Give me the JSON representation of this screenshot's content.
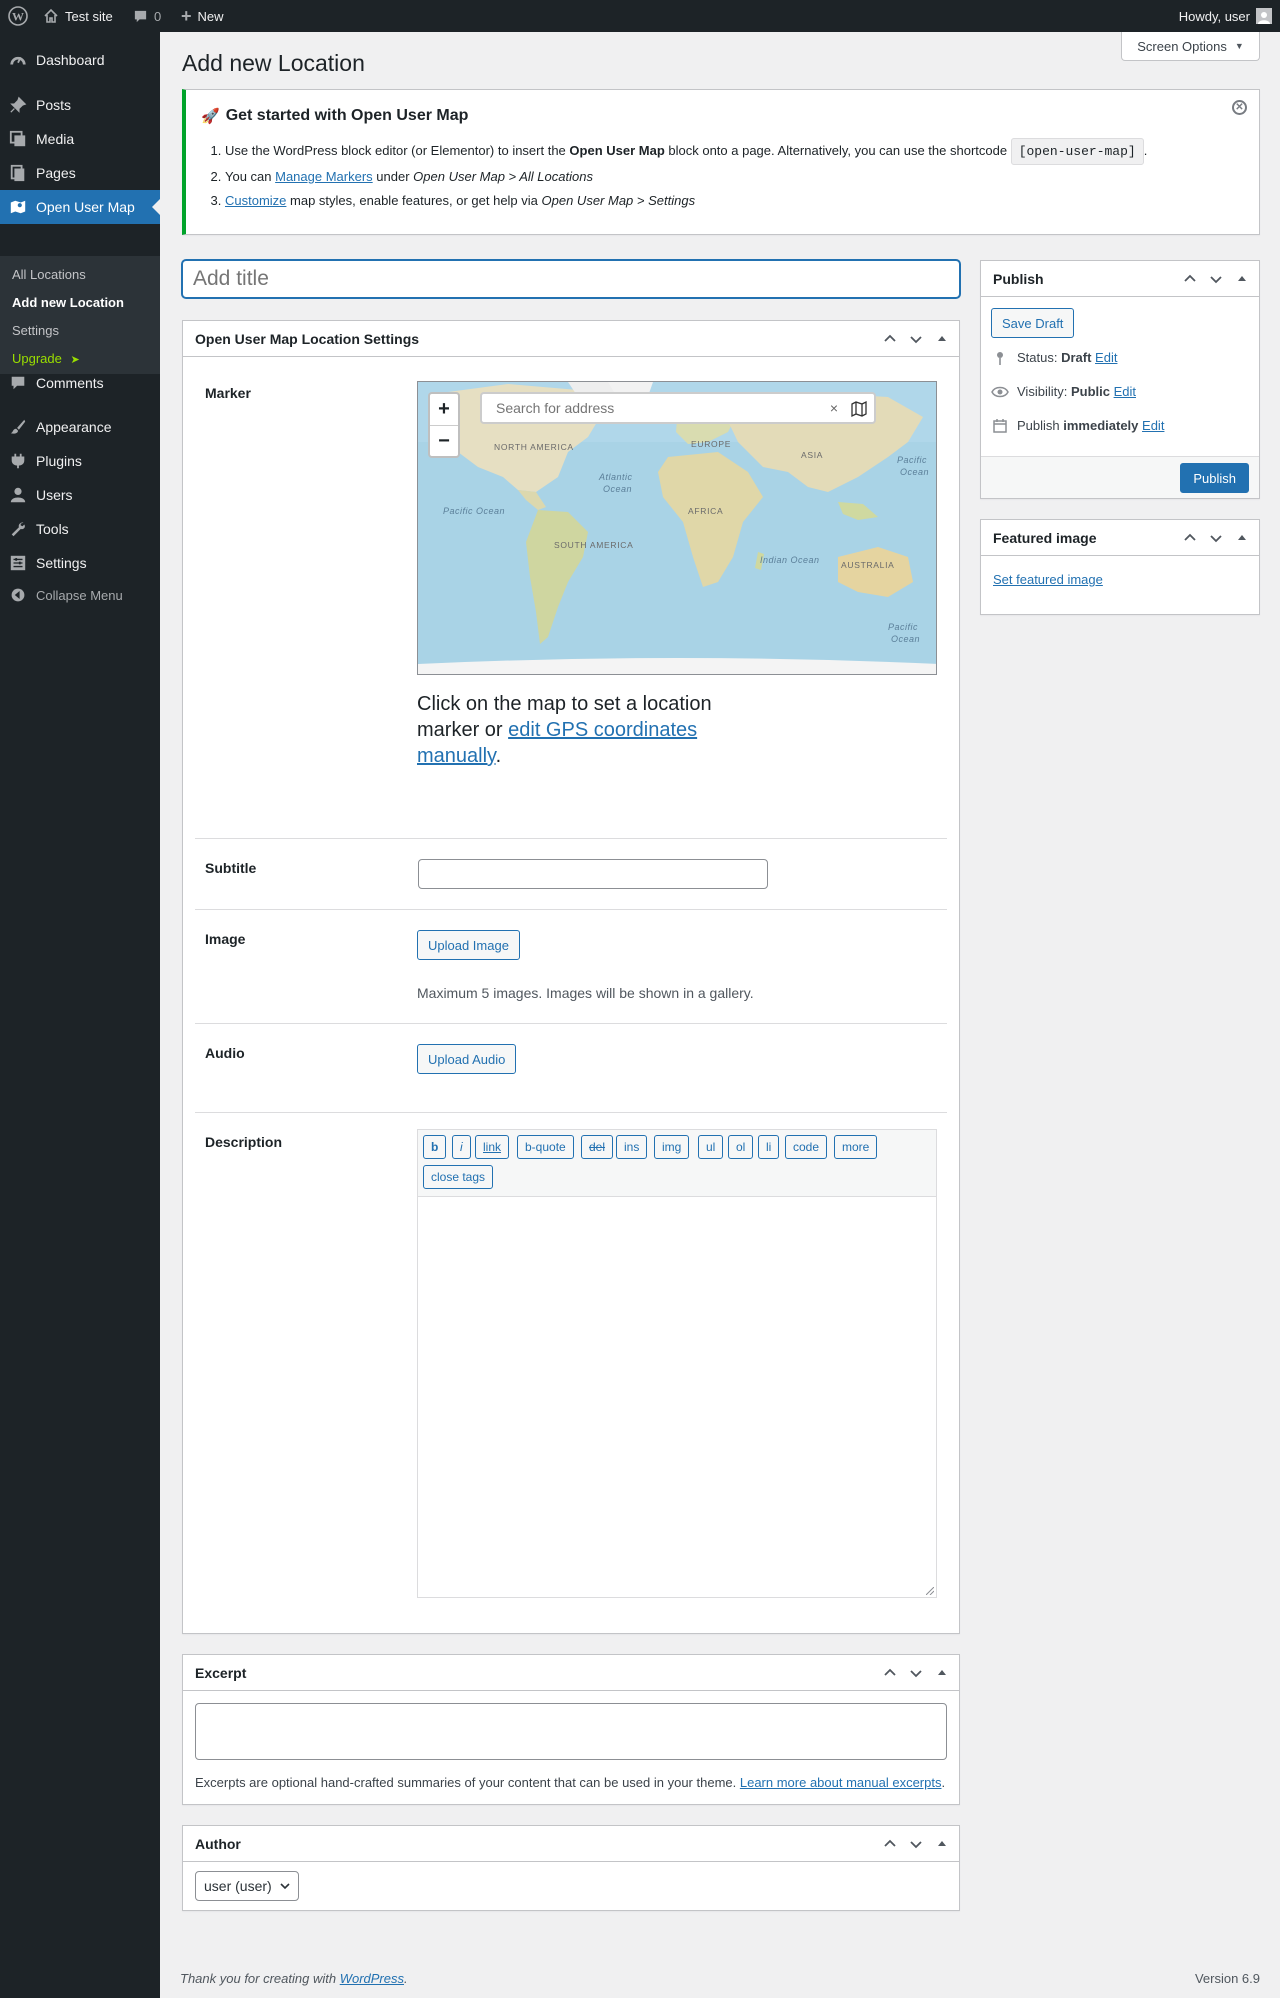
{
  "adminbar": {
    "site_name": "Test site",
    "comments_count": "0",
    "new_label": "New",
    "howdy": "Howdy, user"
  },
  "sidebar": {
    "items": [
      {
        "label": "Dashboard",
        "icon": "dashboard-icon"
      },
      {
        "label": "Posts",
        "icon": "pin-icon"
      },
      {
        "label": "Media",
        "icon": "media-icon"
      },
      {
        "label": "Pages",
        "icon": "pages-icon"
      },
      {
        "label": "Open User Map",
        "icon": "map-icon"
      },
      {
        "label": "Comments",
        "icon": "comments-icon"
      },
      {
        "label": "Appearance",
        "icon": "brush-icon"
      },
      {
        "label": "Plugins",
        "icon": "plug-icon"
      },
      {
        "label": "Users",
        "icon": "users-icon"
      },
      {
        "label": "Tools",
        "icon": "wrench-icon"
      },
      {
        "label": "Settings",
        "icon": "settings-icon"
      }
    ],
    "submenu": [
      "All Locations",
      "Add new Location",
      "Settings",
      "Upgrade"
    ],
    "upgrade_arrow": "➤",
    "collapse": "Collapse Menu"
  },
  "page": {
    "title": "Add new Location",
    "screen_options": "Screen Options",
    "title_placeholder": "Add title"
  },
  "notice": {
    "title": "Get started with Open User Map",
    "step1_a": "Use the WordPress block editor (or Elementor) to insert the ",
    "step1_bold": "Open User Map",
    "step1_b": " block onto a page. Alternatively, you can use the shortcode ",
    "step1_code": "[open-user-map]",
    "step1_c": ".",
    "step2_a": "You can ",
    "step2_link": "Manage Markers",
    "step2_b": " under ",
    "step2_em": "Open User Map > All Locations",
    "step3_link": "Customize",
    "step3_b": " map styles, enable features, or get help via ",
    "step3_em": "Open User Map > Settings"
  },
  "settings_box": {
    "title": "Open User Map Location Settings",
    "marker_label": "Marker",
    "search_placeholder": "Search for address",
    "map_labels": {
      "north_america": "NORTH AMERICA",
      "europe": "EUROPE",
      "asia": "ASIA",
      "atlantic": "Atlantic",
      "ocean": "Ocean",
      "pacific_left": "Pacific Ocean",
      "africa": "AFRICA",
      "south_america": "SOUTH AMERICA",
      "indian": "Indian Ocean",
      "australia": "AUSTRALIA",
      "pacific": "Pacific"
    },
    "hint_a": "Click on the map to set a location marker or ",
    "hint_link": "edit GPS coordinates manually",
    "hint_b": ".",
    "subtitle_label": "Subtitle",
    "subtitle_value": "",
    "image_label": "Image",
    "upload_image": "Upload Image",
    "image_help": "Maximum 5 images. Images will be shown in a gallery.",
    "audio_label": "Audio",
    "upload_audio": "Upload Audio",
    "description_label": "Description",
    "quicktags": [
      "b",
      "i",
      "link",
      "b-quote",
      "del",
      "ins",
      "img",
      "ul",
      "ol",
      "li",
      "code",
      "more"
    ],
    "close_tags": "close tags"
  },
  "excerpt_box": {
    "title": "Excerpt",
    "help_a": "Excerpts are optional hand-crafted summaries of your content that can be used in your theme. ",
    "help_link": "Learn more about manual excerpts",
    "help_b": "."
  },
  "author_box": {
    "title": "Author",
    "selected": "user (user)"
  },
  "publish_box": {
    "title": "Publish",
    "save_draft": "Save Draft",
    "status_label": "Status: ",
    "status_value": "Draft",
    "visibility_label": "Visibility: ",
    "visibility_value": "Public",
    "publish_label": "Publish ",
    "publish_value": "immediately",
    "edit": "Edit",
    "publish_button": "Publish"
  },
  "featured_box": {
    "title": "Featured image",
    "set_link": "Set featured image"
  },
  "footer": {
    "thanks_a": "Thank you for creating with ",
    "thanks_link": "WordPress",
    "thanks_b": ".",
    "version": "Version 6.9"
  },
  "colors": {
    "accent": "#2271b1",
    "sidebar_bg": "#1d2327",
    "notice_border": "#00a32a",
    "upgrade": "#9ade00"
  }
}
